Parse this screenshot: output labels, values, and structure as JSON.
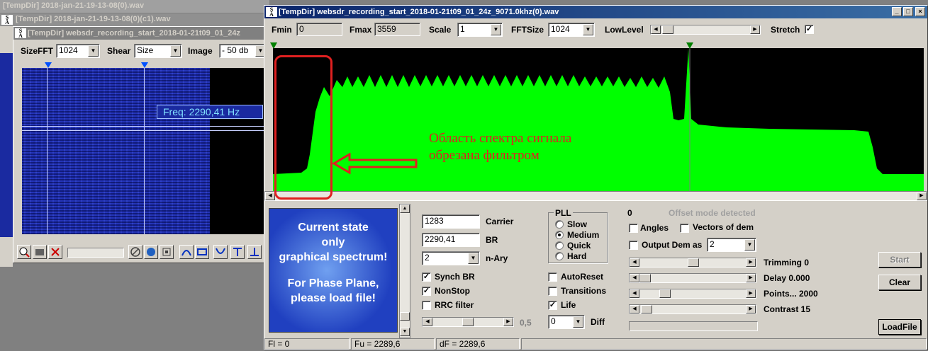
{
  "bg_windows": {
    "title1": "[TempDir] 2018-jan-21-19-13-08(0).wav",
    "title2": "[TempDir] 2018-jan-21-19-13-08(0)(c1).wav"
  },
  "left_window": {
    "title": "[TempDir] websdr_recording_start_2018-01-21t09_01_24z",
    "sizefft_label": "SizeFFT",
    "sizefft_value": "1024",
    "shear_label": "Shear",
    "shear_value": "Size",
    "image_label": "Image",
    "image_value": "- 50 db",
    "freq_tooltip": "Freq: 2290,41 Hz"
  },
  "main_window": {
    "title": "[TempDir] websdr_recording_start_2018-01-21t09_01_24z_9071.0khz(0).wav",
    "fmin_label": "Fmin",
    "fmin_value": "0",
    "fmax_label": "Fmax",
    "fmax_value": "3559",
    "scale_label": "Scale",
    "scale_value": "1",
    "fftsize_label": "FFTSize",
    "fftsize_value": "1024",
    "lowlevel_label": "LowLevel",
    "stretch_label": "Stretch"
  },
  "annotation": {
    "line1": "Область спектра сигнала",
    "line2": "обрезана фильтром"
  },
  "info_panel": {
    "line1": "Current state",
    "line2": "only",
    "line3": "graphical spectrum!",
    "line4": "For Phase Plane,",
    "line5": "please load file!"
  },
  "params": {
    "carrier_value": "1283",
    "carrier_label": "Carrier",
    "br_value": "2290,41",
    "br_label": "BR",
    "nary_value": "2",
    "nary_label": "n-Ary",
    "synch_br": "Synch BR",
    "nonstop": "NonStop",
    "rrc_filter": "RRC filter",
    "slider_value": "0,5",
    "pll_label": "PLL",
    "pll_slow": "Slow",
    "pll_medium": "Medium",
    "pll_quick": "Quick",
    "pll_hard": "Hard",
    "autoreset": "AutoReset",
    "transitions": "Transitions",
    "life": "Life",
    "diff_value": "0",
    "diff_label": "Diff"
  },
  "right_panel": {
    "count": "0",
    "offset_text": "Offset mode detected",
    "angles": "Angles",
    "vectors": "Vectors of dem",
    "output_dem": "Output Dem as",
    "output_dem_value": "2",
    "trimming": "Trimming 0",
    "delay": "Delay  0.000",
    "points": "Points... 2000",
    "contrast": "Contrast 15",
    "start_btn": "Start",
    "clear_btn": "Clear",
    "loadfile_btn": "LoadFile"
  },
  "status": {
    "fl": "Fl = 0",
    "fu": "Fu = 2289,6",
    "df": "dF = 2289,6"
  },
  "colors": {
    "spectrum": "#00ff00",
    "annotation": "#e02020",
    "panel_blue": "#2040c0"
  }
}
